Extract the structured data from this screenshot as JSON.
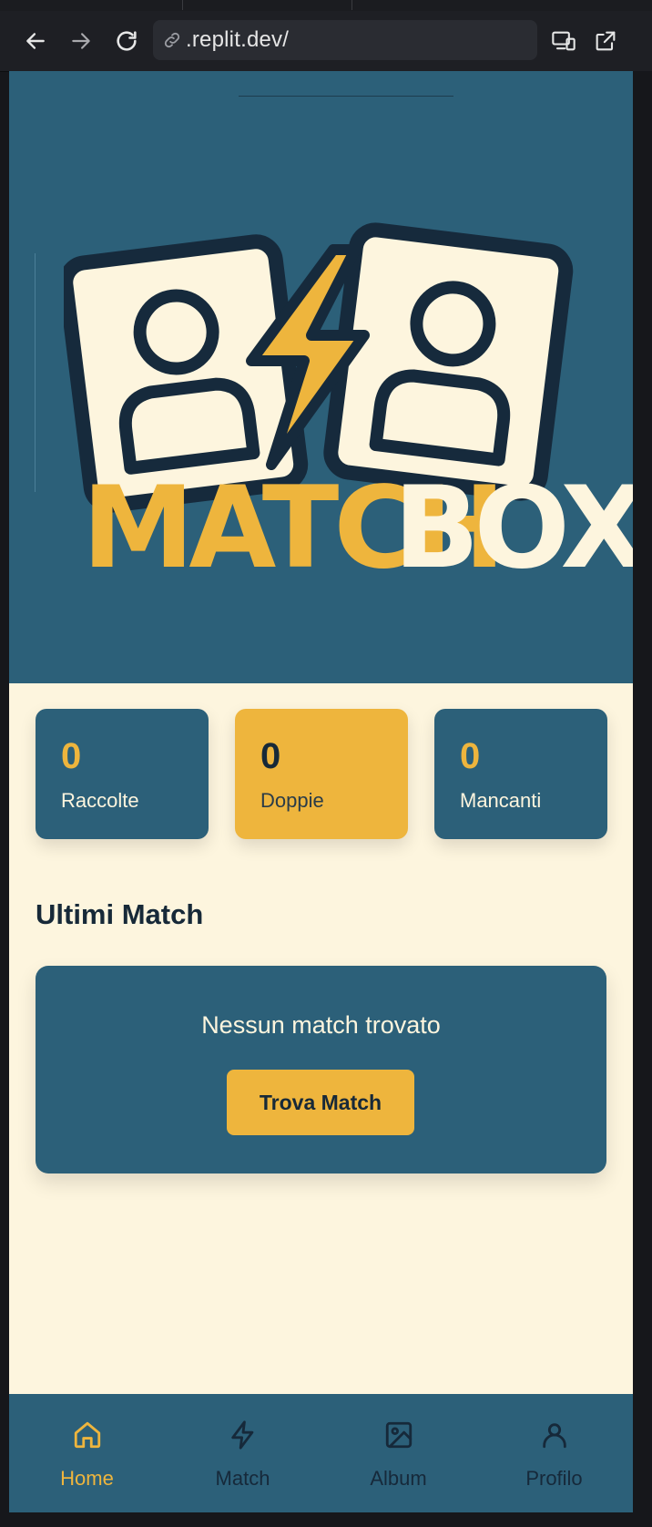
{
  "browser": {
    "url": ".replit.dev/",
    "icons": [
      "back-arrow-icon",
      "forward-arrow-icon",
      "reload-icon",
      "link-icon",
      "device-emulation-icon",
      "open-external-icon"
    ]
  },
  "hero": {
    "brand_part1": "MATCH",
    "brand_part2": "BOX"
  },
  "stats": [
    {
      "value": "0",
      "label": "Raccolte"
    },
    {
      "value": "0",
      "label": "Doppie"
    },
    {
      "value": "0",
      "label": "Mancanti"
    }
  ],
  "recent": {
    "title": "Ultimi Match",
    "empty_text": "Nessun match trovato",
    "button_label": "Trova Match"
  },
  "tabs": [
    {
      "label": "Home",
      "icon": "home-icon",
      "active": true
    },
    {
      "label": "Match",
      "icon": "lightning-icon",
      "active": false
    },
    {
      "label": "Album",
      "icon": "image-icon",
      "active": false
    },
    {
      "label": "Profilo",
      "icon": "user-icon",
      "active": false
    }
  ],
  "colors": {
    "primary": "#2c6079",
    "accent": "#eeb53d",
    "background": "#fdf5de",
    "dark": "#172938"
  }
}
